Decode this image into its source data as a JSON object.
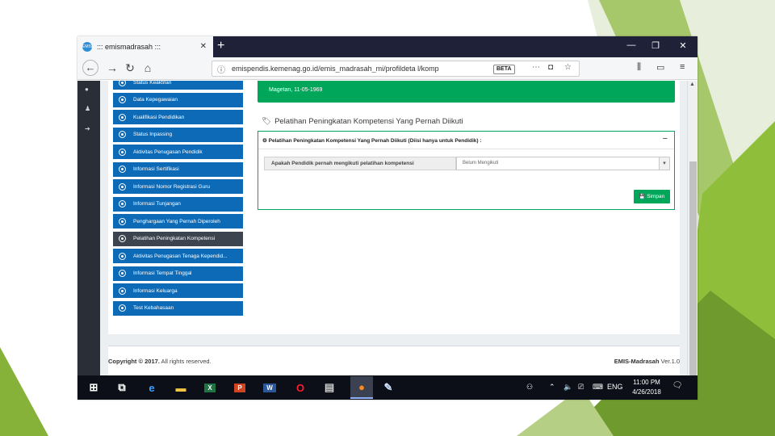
{
  "browser": {
    "tab_title": "::: emismadrasah :::",
    "tab_favicon": "EMIS",
    "close_glyph": "✕",
    "new_tab_glyph": "+",
    "url": "emispendis.kemenag.go.id/emis_madrasah_mi/profildeta l/komp",
    "url_badge": "BETA",
    "window_minimize": "—",
    "window_restore": "❐",
    "window_close": "✕"
  },
  "sidebar": {
    "items": [
      {
        "label": "Status Keaktifan",
        "icon": "circle-dot-icon",
        "active": false
      },
      {
        "label": "Data Kepegawaian",
        "icon": "circle-dot-icon",
        "active": false
      },
      {
        "label": "Kualifikasi Pendidikan",
        "icon": "circle-dot-icon",
        "active": false
      },
      {
        "label": "Status Inpassing",
        "icon": "circle-dot-icon",
        "active": false
      },
      {
        "label": "Aktivitas Penugasan Pendidik",
        "icon": "circle-dot-icon",
        "active": false
      },
      {
        "label": "Informasi Sertifikasi",
        "icon": "circle-dot-icon",
        "active": false
      },
      {
        "label": "Informasi Nomor Registrasi Guru",
        "icon": "circle-dot-icon",
        "active": false
      },
      {
        "label": "Informasi Tunjangan",
        "icon": "circle-dot-icon",
        "active": false
      },
      {
        "label": "Penghargaan Yang Pernah Diperoleh",
        "icon": "circle-dot-icon",
        "active": false
      },
      {
        "label": "Pelatihan Peningkatan Kompetensi",
        "icon": "circle-dot-icon",
        "active": true
      },
      {
        "label": "Aktivitas Penugasan Tenaga Kependid...",
        "icon": "circle-dot-icon",
        "active": false
      },
      {
        "label": "Informasi Tempat Tinggal",
        "icon": "circle-dot-icon",
        "active": false
      },
      {
        "label": "Informasi Keluarga",
        "icon": "circle-dot-icon",
        "active": false
      },
      {
        "label": "Test Kebahasaan",
        "icon": "circle-dot-icon",
        "active": false
      }
    ]
  },
  "profile_box": {
    "birth_text": "Magetan, 11-05-1969"
  },
  "section": {
    "title": "Pelatihan Peningkatan Kompetensi Yang Pernah Diikuti",
    "panel_title": "Pelatihan Peningkatan Kompetensi Yang Pernah Diikuti (Diisi hanya untuk Pendidik) :",
    "panel_toggle": "−",
    "question_label": "Apakah Pendidik pernah mengikuti pelatihan kompetensi",
    "select_value": "Belum Mengikuti",
    "save_label": "Simpan"
  },
  "footer": {
    "copyright": "Copyright © 2017.",
    "rights": "All rights reserved.",
    "app_name": "EMIS-Madrasah",
    "version": "Ver.1.0"
  },
  "taskbar": {
    "items": [
      {
        "name": "windows-start-icon",
        "glyph": "⊞",
        "color": "#ffffff",
        "bg": "transparent"
      },
      {
        "name": "task-view-icon",
        "glyph": "⧉",
        "color": "#ffffff",
        "bg": "transparent"
      },
      {
        "name": "edge-icon",
        "glyph": "e",
        "color": "#3aa0ff",
        "bg": "transparent"
      },
      {
        "name": "file-explorer-icon",
        "glyph": "▬",
        "color": "#f4c542",
        "bg": "transparent"
      },
      {
        "name": "excel-icon",
        "glyph": "X",
        "color": "#ffffff",
        "bg": "#1f7244"
      },
      {
        "name": "powerpoint-icon",
        "glyph": "P",
        "color": "#ffffff",
        "bg": "#d04423"
      },
      {
        "name": "word-icon",
        "glyph": "W",
        "color": "#ffffff",
        "bg": "#2b579a"
      },
      {
        "name": "opera-icon",
        "glyph": "O",
        "color": "#ff1b2d",
        "bg": "transparent"
      },
      {
        "name": "printer-app-icon",
        "glyph": "▤",
        "color": "#cfcfcf",
        "bg": "transparent"
      },
      {
        "name": "firefox-icon",
        "glyph": "●",
        "color": "#ff8a1c",
        "bg": "transparent"
      },
      {
        "name": "paint-app-icon",
        "glyph": "✎",
        "color": "#cfe3ff",
        "bg": "transparent"
      }
    ],
    "language": "ENG",
    "time": "11:00 PM",
    "date": "4/26/2018"
  }
}
